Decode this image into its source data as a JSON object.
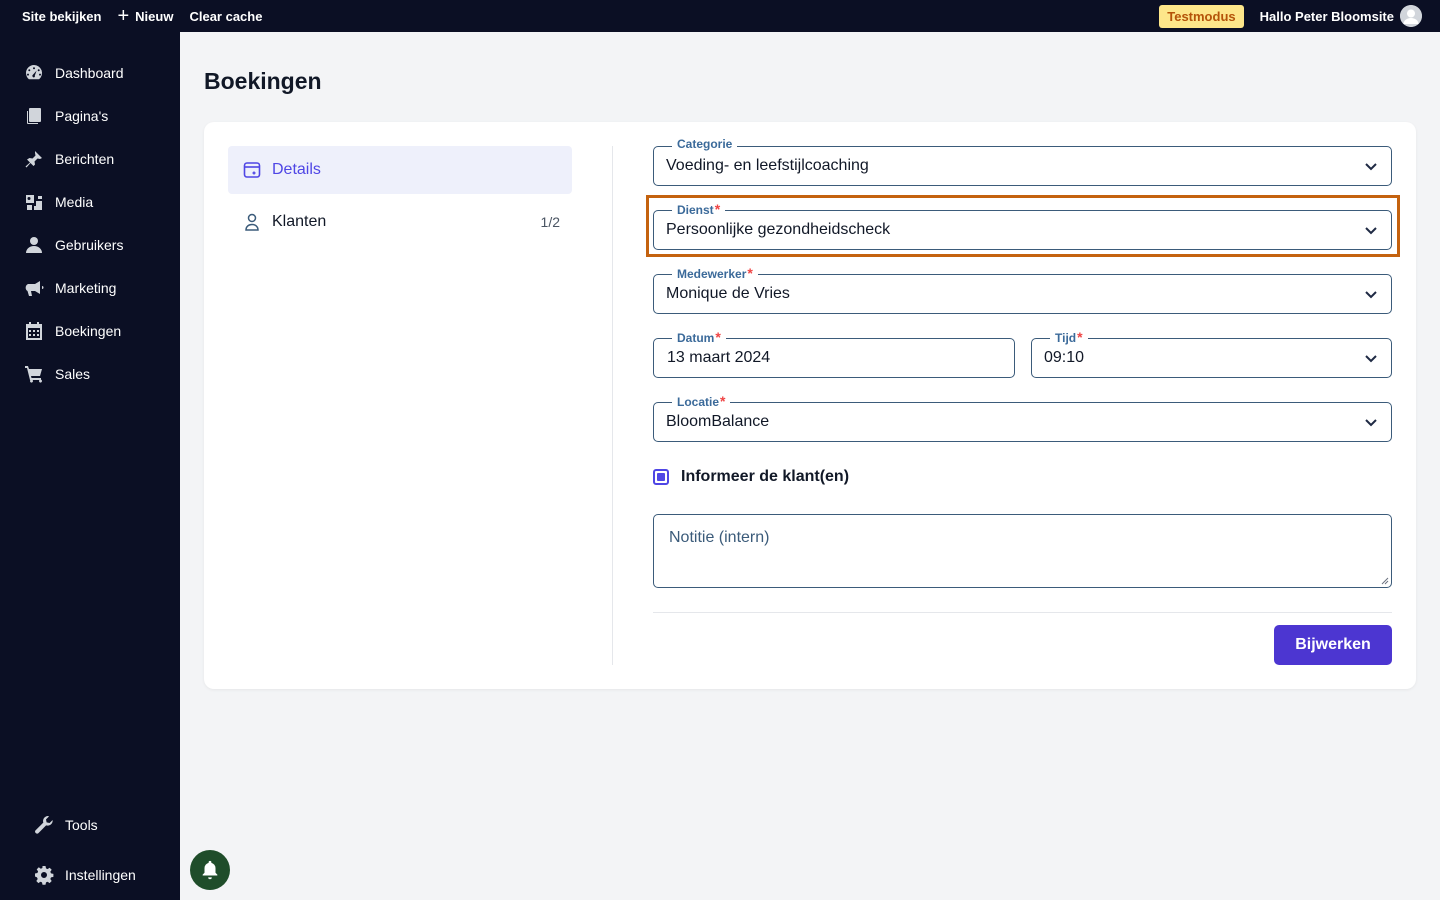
{
  "topbar": {
    "view_site": "Site bekijken",
    "new_label": "Nieuw",
    "clear_cache": "Clear cache",
    "mode_badge": "Testmodus",
    "greeting": "Hallo Peter Bloomsite"
  },
  "sidebar": {
    "items": [
      {
        "label": "Dashboard",
        "icon": "dashboard-icon"
      },
      {
        "label": "Pagina's",
        "icon": "pages-icon"
      },
      {
        "label": "Berichten",
        "icon": "pin-icon"
      },
      {
        "label": "Media",
        "icon": "media-icon"
      },
      {
        "label": "Gebruikers",
        "icon": "user-icon"
      },
      {
        "label": "Marketing",
        "icon": "megaphone-icon"
      },
      {
        "label": "Boekingen",
        "icon": "calendar-icon"
      },
      {
        "label": "Sales",
        "icon": "cart-icon"
      }
    ],
    "bottom": [
      {
        "label": "Tools",
        "icon": "wrench-icon"
      },
      {
        "label": "Instellingen",
        "icon": "gear-icon"
      }
    ]
  },
  "page": {
    "title": "Boekingen"
  },
  "tabs": [
    {
      "label": "Details",
      "icon": "calendar-small-icon",
      "active": true
    },
    {
      "label": "Klanten",
      "icon": "person-icon",
      "count": "1/2"
    }
  ],
  "form": {
    "categorie": {
      "label": "Categorie",
      "value": "Voeding- en leefstijlcoaching"
    },
    "dienst": {
      "label": "Dienst",
      "value": "Persoonlijke gezondheidscheck"
    },
    "medewerker": {
      "label": "Medewerker",
      "value": "Monique de Vries"
    },
    "datum": {
      "label": "Datum",
      "value": "13 maart 2024"
    },
    "tijd": {
      "label": "Tijd",
      "value": "09:10"
    },
    "locatie": {
      "label": "Locatie",
      "value": "BloomBalance"
    },
    "notify_label": "Informeer de klant(en)",
    "notify_checked": true,
    "note_placeholder": "Notitie (intern)",
    "submit_label": "Bijwerken",
    "required_mark": "*"
  },
  "colors": {
    "accent": "#4c36d1",
    "highlight": "#c4620f",
    "sidebar_bg": "#0b0f24",
    "badge_bg": "#fde68a"
  }
}
